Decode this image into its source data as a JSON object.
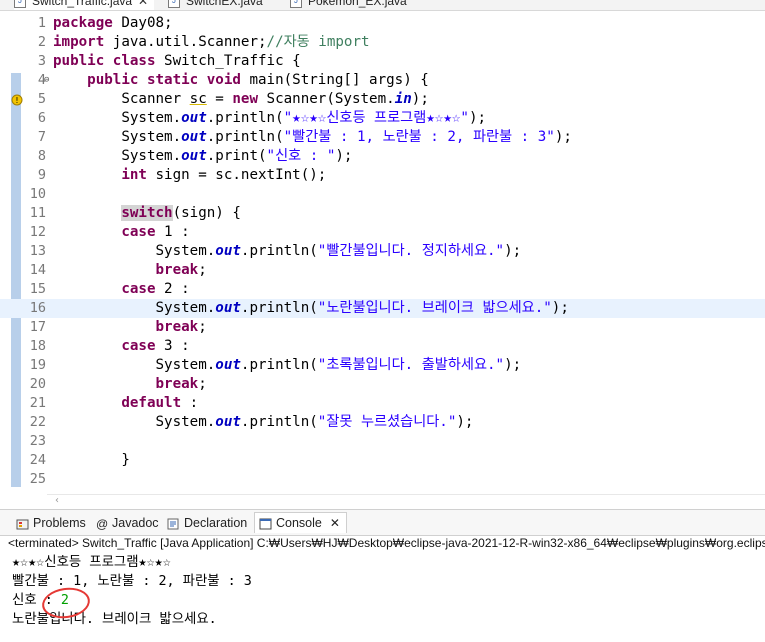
{
  "editor_tabs": [
    {
      "label": "Switch_Traffic.java",
      "active": true,
      "closable": true
    },
    {
      "label": "SwitchEX.java",
      "active": false,
      "closable": false
    },
    {
      "label": "Pokemon_EX.java",
      "active": false,
      "closable": false
    }
  ],
  "code_lines": [
    {
      "n": "1",
      "html": "<span class='kw'>package</span> Day08;"
    },
    {
      "n": "2",
      "html": "<span class='kw'>import</span> java.util.Scanner;<span class='cmt'>//자동 import</span>"
    },
    {
      "n": "3",
      "html": "<span class='kw'>public</span> <span class='kw'>class</span> Switch_Traffic {"
    },
    {
      "n": "4",
      "html": "    <span class='kw'>public</span> <span class='kw'>static</span> <span class='kw'>void</span> main(String[] args) {"
    },
    {
      "n": "5",
      "html": "        Scanner <u style='text-decoration-color:#d6b800;'>sc</u> = <span class='kw'>new</span> Scanner(System.<span class='fld'>in</span>);"
    },
    {
      "n": "6",
      "html": "        System.<span class='fld'>out</span>.println(<span class='str'>\"★☆★☆신호등 프로그램★☆★☆\"</span>);"
    },
    {
      "n": "7",
      "html": "        System.<span class='fld'>out</span>.println(<span class='str'>\"빨간불 : 1, 노란불 : 2, 파란불 : 3\"</span>);"
    },
    {
      "n": "8",
      "html": "        System.<span class='fld'>out</span>.print(<span class='str'>\"신호 : \"</span>);"
    },
    {
      "n": "9",
      "html": "        <span class='kw'>int</span> sign = sc.nextInt();"
    },
    {
      "n": "10",
      "html": ""
    },
    {
      "n": "11",
      "html": "        <span class='kw sw'>switch</span>(sign) {"
    },
    {
      "n": "12",
      "html": "        <span class='kw'>case</span> 1 :"
    },
    {
      "n": "13",
      "html": "            System.<span class='fld'>out</span>.println(<span class='str'>\"빨간불입니다. 정지하세요.\"</span>);"
    },
    {
      "n": "14",
      "html": "            <span class='kw'>break</span>;"
    },
    {
      "n": "15",
      "html": "        <span class='kw'>case</span> 2 :"
    },
    {
      "n": "16",
      "html": "            System.<span class='fld'>out</span>.println(<span class='str'>\"노란불입니다. 브레이크 밟으세요.\"</span>);"
    },
    {
      "n": "17",
      "html": "            <span class='kw'>break</span>;"
    },
    {
      "n": "18",
      "html": "        <span class='kw'>case</span> 3 :"
    },
    {
      "n": "19",
      "html": "            System.<span class='fld'>out</span>.println(<span class='str'>\"초록불입니다. 출발하세요.\"</span>);"
    },
    {
      "n": "20",
      "html": "            <span class='kw'>break</span>;"
    },
    {
      "n": "21",
      "html": "        <span class='kw'>default</span> :"
    },
    {
      "n": "22",
      "html": "            System.<span class='fld'>out</span>.println(<span class='str'>\"잘못 누르셨습니다.\"</span>);"
    },
    {
      "n": "23",
      "html": ""
    },
    {
      "n": "24",
      "html": "        }"
    },
    {
      "n": "25",
      "html": ""
    }
  ],
  "highlighted_line": "16",
  "panel_tabs": [
    {
      "label": "Problems",
      "icon": "problems-icon",
      "active": false
    },
    {
      "label": "Javadoc",
      "icon": "javadoc-icon",
      "active": false
    },
    {
      "label": "Declaration",
      "icon": "declaration-icon",
      "active": false
    },
    {
      "label": "Console",
      "icon": "console-icon",
      "active": true
    }
  ],
  "console": {
    "terminated": "<terminated> Switch_Traffic [Java Application] C:₩Users₩HJ₩Desktop₩eclipse-java-2021-12-R-win32-x86_64₩eclipse₩plugins₩org.eclipse",
    "line1": "★☆★☆신호등 프로그램★☆★☆",
    "line2": "빨간불 : 1, 노란불 : 2, 파란불 : 3",
    "prompt": "신호 : ",
    "input": "2",
    "line4": "노란불입니다. 브레이크 밟으세요."
  },
  "colors": {
    "keyword": "#7f0055",
    "string": "#2a00ff",
    "field": "#0000c0",
    "comment": "#3f7f5f",
    "line_highlight": "#e8f2fe",
    "input_circle": "#e53935"
  }
}
